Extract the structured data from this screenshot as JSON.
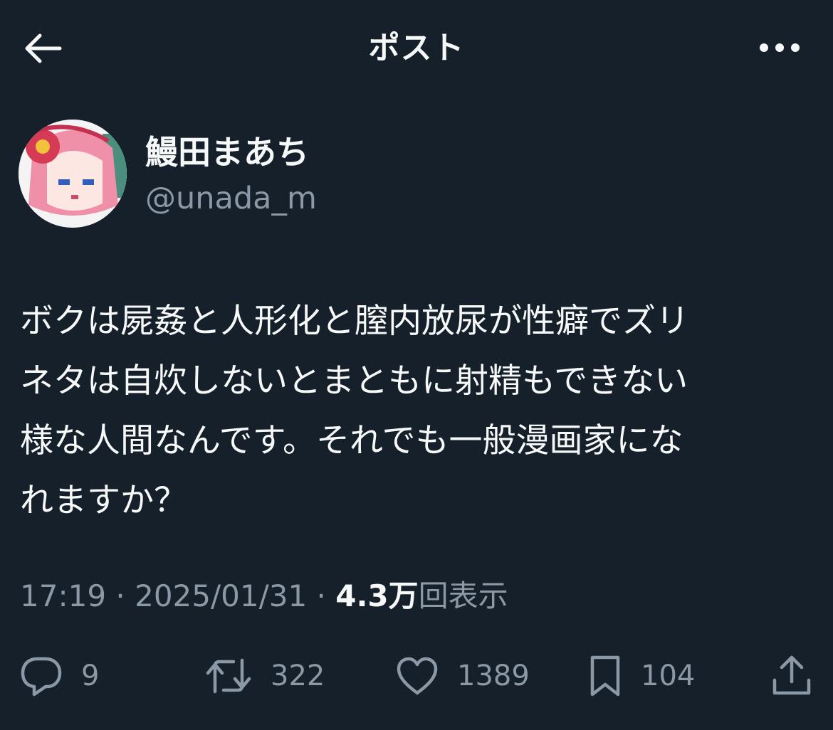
{
  "header": {
    "title": "ポスト",
    "back_icon": "back-arrow-icon",
    "more_icon": "more-dots-icon"
  },
  "author": {
    "display_name": "鰻田まあち",
    "handle": "@unada_m"
  },
  "post": {
    "text": "ボクは屍姦と人形化と膣内放尿が性癖でズリ\nネタは自炊しないとまともに射精もできない\n様な人間なんです。それでも一般漫画家にな\nれますか？"
  },
  "meta": {
    "time": "17:19",
    "separator": " · ",
    "date": "2025/01/31",
    "views_count": "4.3万",
    "views_label": "回表示"
  },
  "actions": {
    "reply": {
      "icon": "reply-icon",
      "count": "9"
    },
    "repost": {
      "icon": "repost-icon",
      "count": "322"
    },
    "like": {
      "icon": "heart-icon",
      "count": "1389"
    },
    "bookmark": {
      "icon": "bookmark-icon",
      "count": "104"
    },
    "share": {
      "icon": "share-icon"
    }
  },
  "colors": {
    "background": "#15202b",
    "text": "#f7f9f9",
    "secondary": "#8b98a5"
  }
}
